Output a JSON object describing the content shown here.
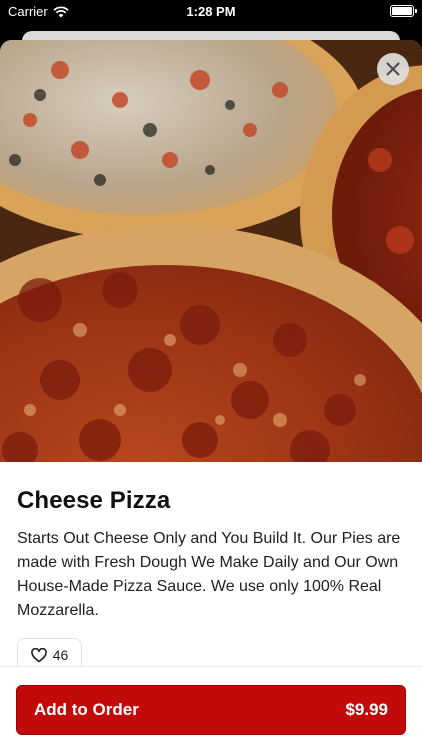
{
  "status": {
    "carrier": "Carrier",
    "time": "1:28 PM"
  },
  "item": {
    "name": "Cheese Pizza",
    "description": "Starts Out Cheese Only and You Build It. Our Pies are made with Fresh Dough We Make Daily and Our Own House-Made Pizza Sauce. We use only 100% Real Mozzarella.",
    "likes": "46"
  },
  "footer": {
    "add_label": "Add to Order",
    "price": "$9.99"
  },
  "icons": {
    "close": "close-icon",
    "like": "heart-icon",
    "wifi": "wifi-icon",
    "battery": "battery-icon"
  },
  "colors": {
    "primary": "#c20a0a",
    "text": "#111111"
  }
}
